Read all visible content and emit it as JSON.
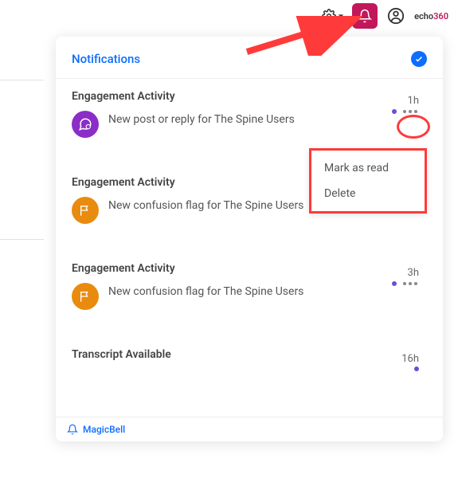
{
  "topbar": {
    "logo_text_prefix": "echo",
    "logo_text_suffix": "360"
  },
  "panel": {
    "title": "Notifications",
    "footer_brand": "MagicBell"
  },
  "context_menu": {
    "mark_read": "Mark as read",
    "delete": "Delete"
  },
  "groups": [
    {
      "title": "Engagement Activity",
      "icon": "chat",
      "color": "purple",
      "text": "New post or reply for The Spine Users",
      "time": "1h"
    },
    {
      "title": "Engagement Activity",
      "icon": "flag",
      "color": "orange",
      "text": "New confusion flag for The Spine Users",
      "time": ""
    },
    {
      "title": "Engagement Activity",
      "icon": "flag",
      "color": "orange",
      "text": "New confusion flag for The Spine Users",
      "time": "3h"
    },
    {
      "title": "Transcript Available",
      "icon": "doc",
      "color": "orange",
      "text": "",
      "time": "16h"
    }
  ]
}
